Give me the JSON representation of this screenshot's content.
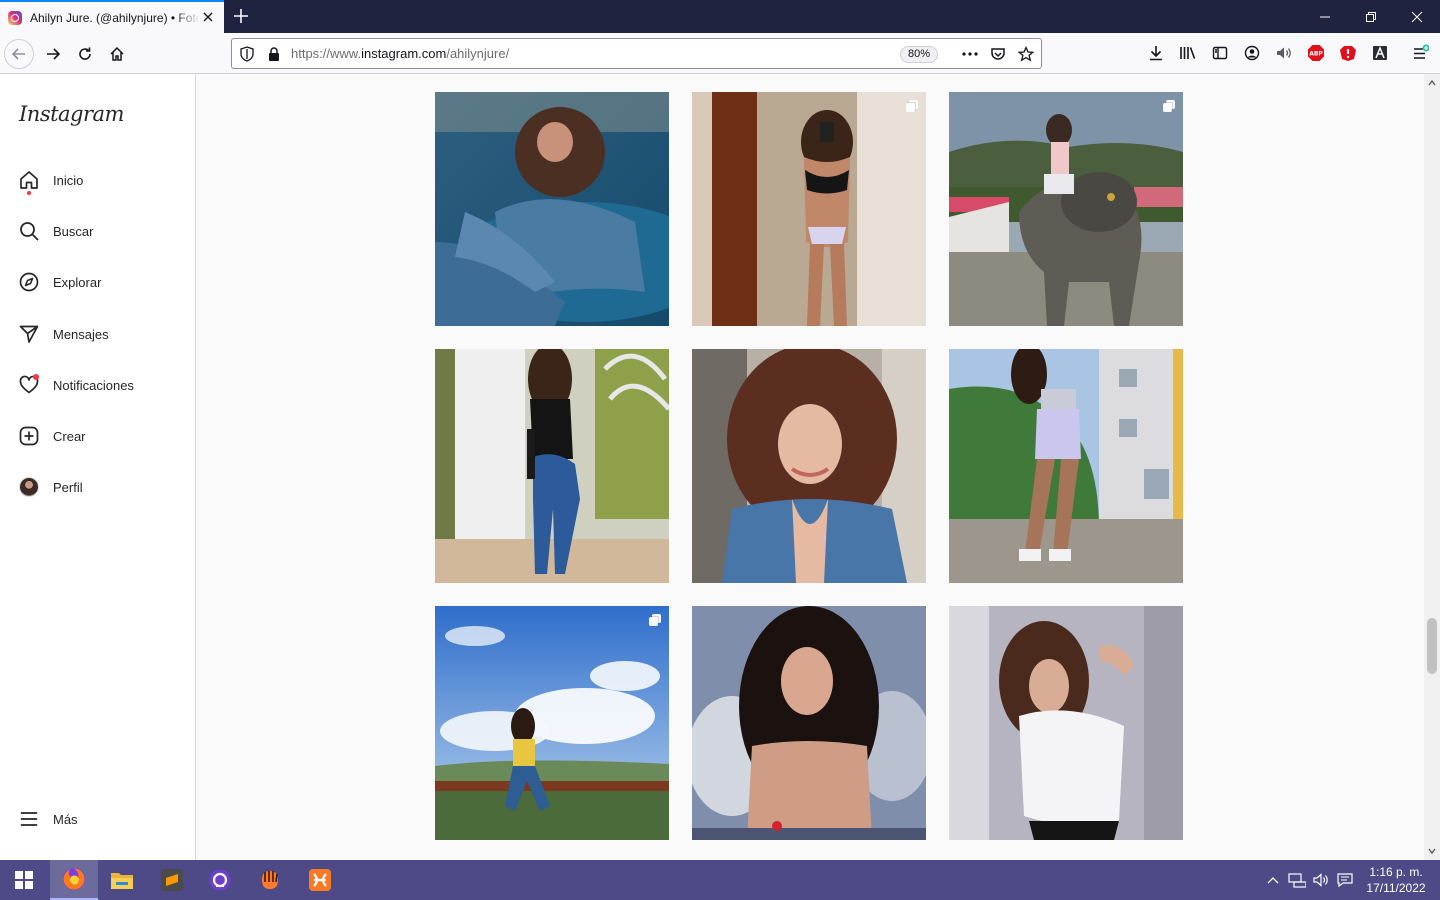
{
  "browser": {
    "tab_title": "Ahilyn Jure. (@ahilynjure) • Fotos y videos de Instagram",
    "url_prefix": "https://www.",
    "url_host": "instagram.com",
    "url_path": "/ahilynjure/",
    "zoom": "80%",
    "accent_color": "#0a84ff",
    "icons": [
      "back-icon",
      "forward-icon",
      "reload-icon",
      "home-icon",
      "shield-icon",
      "lock-icon",
      "more-icon",
      "pocket-icon",
      "star-icon",
      "download-icon",
      "library-icon",
      "sidebar-icon",
      "account-icon",
      "speaker-icon",
      "adblock-icon",
      "extension-icon",
      "extension-icon-2",
      "menu-icon"
    ]
  },
  "instagram": {
    "logo": "Instagram",
    "nav": [
      {
        "label": "Inicio",
        "icon": "home-icon",
        "has_dot": true
      },
      {
        "label": "Buscar",
        "icon": "search-icon"
      },
      {
        "label": "Explorar",
        "icon": "compass-icon"
      },
      {
        "label": "Mensajes",
        "icon": "paper-plane-icon"
      },
      {
        "label": "Notificaciones",
        "icon": "heart-icon",
        "has_dot": true
      },
      {
        "label": "Crear",
        "icon": "plus-square-icon"
      },
      {
        "label": "Perfil",
        "icon": "avatar"
      }
    ],
    "more_label": "Más",
    "posts": [
      {
        "description": "woman with curly hair in denim on blue sofa",
        "multi": false
      },
      {
        "description": "mirror selfie in bikini",
        "multi": true
      },
      {
        "description": "woman on lion statue",
        "multi": true
      },
      {
        "description": "woman in jeans in garden",
        "multi": false
      },
      {
        "description": "curly hair close-up portrait",
        "multi": false
      },
      {
        "description": "woman in white shorts near building",
        "multi": false
      },
      {
        "description": "woman sitting on railing under blue sky",
        "multi": true
      },
      {
        "description": "curly hair studio portrait with wings",
        "multi": false
      },
      {
        "description": "woman in white shirt studio portrait",
        "multi": false
      }
    ]
  },
  "taskbar": {
    "apps": [
      "windows-start-icon",
      "firefox-icon",
      "file-explorer-icon",
      "sublime-text-icon",
      "github-desktop-icon",
      "app-icon",
      "xampp-icon"
    ],
    "time": "1:16 p. m.",
    "date": "17/11/2022",
    "color": "#4d4a87"
  }
}
